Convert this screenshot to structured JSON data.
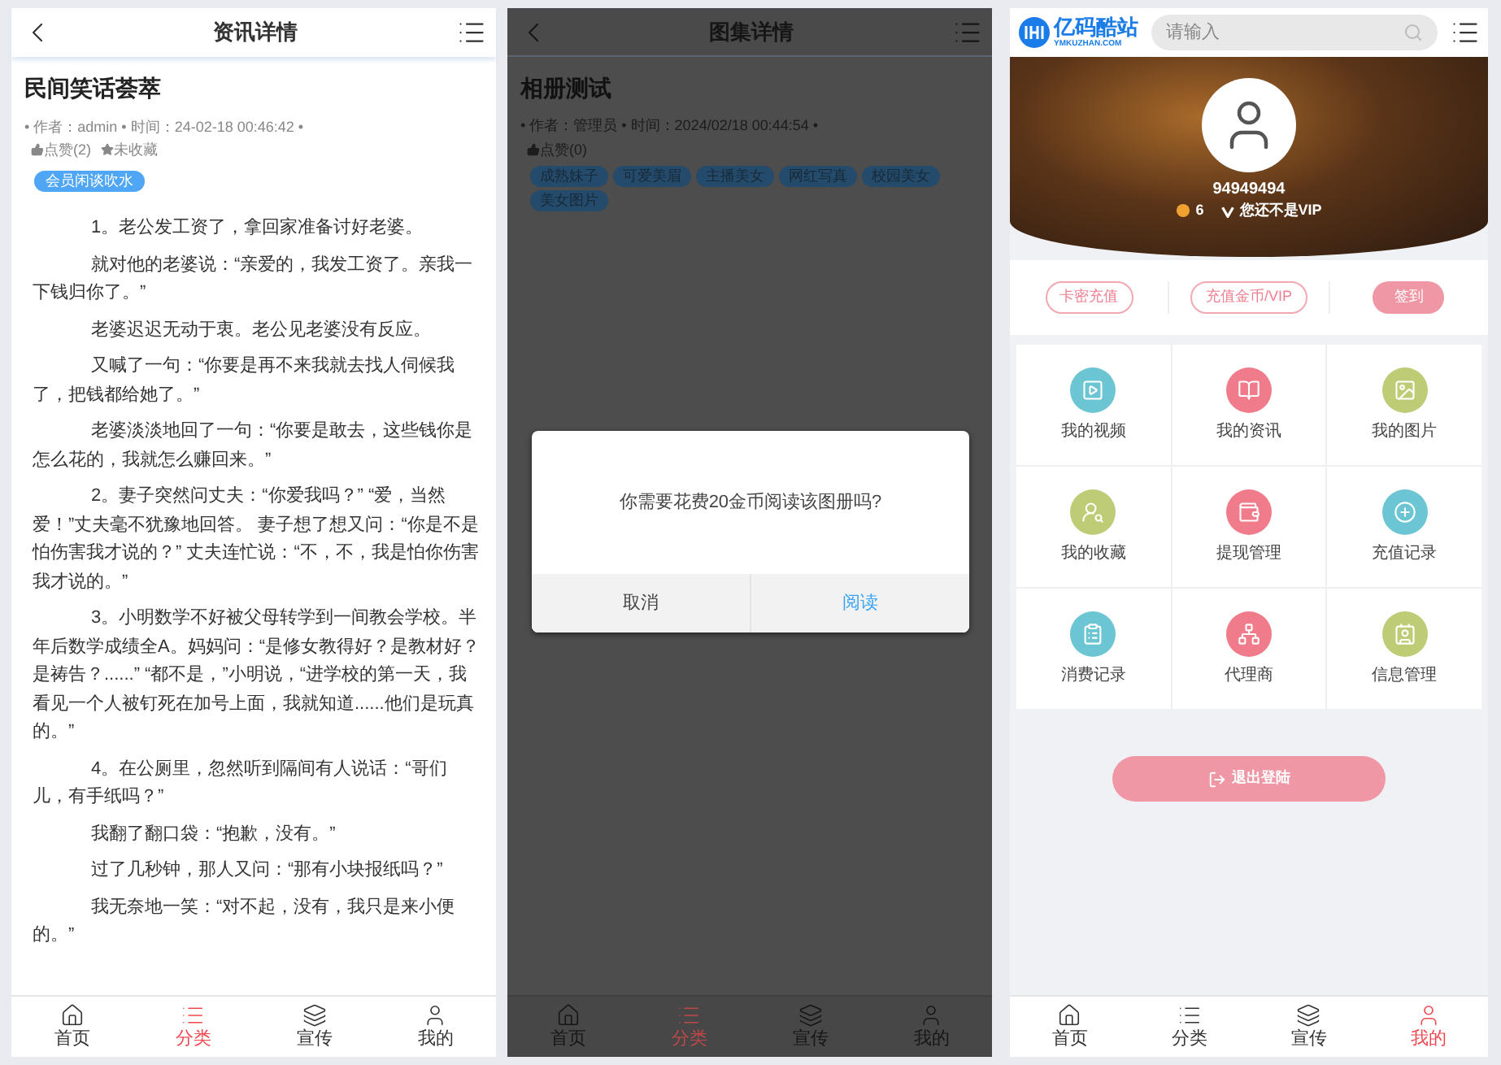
{
  "news_detail": {
    "header": {
      "title": "资讯详情"
    },
    "article": {
      "title": "民间笑话荟萃",
      "meta": "• 作者：admin • 时间：24-02-18 00:46:42 •",
      "likes": "点赞(2)",
      "favorite": "未收藏",
      "tag": "会员闲谈吹水",
      "paragraphs": [
        "1。老公发工资了，拿回家准备讨好老婆。",
        "就对他的老婆说：“亲爱的，我发工资了。亲我一下钱归你了。”",
        "老婆迟迟无动于衷。老公见老婆没有反应。",
        "又喊了一句：“你要是再不来我就去找人伺候我了，把钱都给她了。”",
        "老婆淡淡地回了一句：“你要是敢去，这些钱你是怎么花的，我就怎么赚回来。”",
        "2。妻子突然问丈夫：“你爱我吗？” “爱，当然爱！”丈夫毫不犹豫地回答。 妻子想了想又问：“你是不是怕伤害我才说的？” 丈夫连忙说：“不，不，我是怕你伤害我才说的。”",
        "3。小明数学不好被父母转学到一间教会学校。半年后数学成绩全A。妈妈问：“是修女教得好？是教材好？是祷告？......” “都不是，”小明说，“进学校的第一天，我看见一个人被钉死在加号上面，我就知道......他们是玩真的。”",
        "4。在公厕里，忽然听到隔间有人说话：“哥们儿，有手纸吗？”",
        "我翻了翻口袋：“抱歉，没有。”",
        "过了几秒钟，那人又问：“那有小块报纸吗？”",
        "我无奈地一笑：“对不起，没有，我只是来小便的。”"
      ]
    },
    "bottom_nav": [
      {
        "label": "首页",
        "selected": false
      },
      {
        "label": "分类",
        "selected": true
      },
      {
        "label": "宣传",
        "selected": false
      },
      {
        "label": "我的",
        "selected": false
      }
    ]
  },
  "album_detail": {
    "header": {
      "title": "图集详情"
    },
    "album": {
      "title": "相册测试",
      "meta": "• 作者：管理员 • 时间：2024/02/18 00:44:54 •",
      "likes": "点赞(0)",
      "tags": [
        "成熟妹子",
        "可爱美眉",
        "主播美女",
        "网红写真",
        "校园美女",
        "美女图片"
      ]
    },
    "dialog": {
      "message": "你需要花费20金币阅读该图册吗?",
      "buttons": [
        {
          "label": "取消",
          "kind": "cancel"
        },
        {
          "label": "阅读",
          "kind": "confirm"
        }
      ]
    },
    "bottom_nav": [
      {
        "label": "首页",
        "selected": false
      },
      {
        "label": "分类",
        "selected": true
      },
      {
        "label": "宣传",
        "selected": false
      },
      {
        "label": "我的",
        "selected": false
      }
    ]
  },
  "profile": {
    "header": {
      "logo_name": "亿码酷站",
      "logo_domain": "YMKUZHAN.COM",
      "search": {
        "placeholder": "请输入"
      }
    },
    "user": {
      "name": "94949494",
      "coins": "6",
      "vip_status": "您还不是VIP"
    },
    "actions": [
      {
        "label": "卡密充值",
        "kind": "outline"
      },
      {
        "label": "充值金币/VIP",
        "kind": "outline"
      },
      {
        "label": "签到",
        "kind": "filled"
      }
    ],
    "menu": [
      {
        "label": "我的视频",
        "color": "#6cc5d3"
      },
      {
        "label": "我的资讯",
        "color": "#f07b8b"
      },
      {
        "label": "我的图片",
        "color": "#bfcc76"
      },
      {
        "label": "我的收藏",
        "color": "#bfcc76"
      },
      {
        "label": "提现管理",
        "color": "#f07b8b"
      },
      {
        "label": "充值记录",
        "color": "#6cc5d3"
      },
      {
        "label": "消费记录",
        "color": "#6cc5d3"
      },
      {
        "label": "代理商",
        "color": "#f07b8b"
      },
      {
        "label": "信息管理",
        "color": "#bfcc76"
      }
    ],
    "logout": "退出登陆",
    "bottom_nav": [
      {
        "label": "首页",
        "selected": false
      },
      {
        "label": "分类",
        "selected": false
      },
      {
        "label": "宣传",
        "selected": false
      },
      {
        "label": "我的",
        "selected": true
      }
    ]
  }
}
